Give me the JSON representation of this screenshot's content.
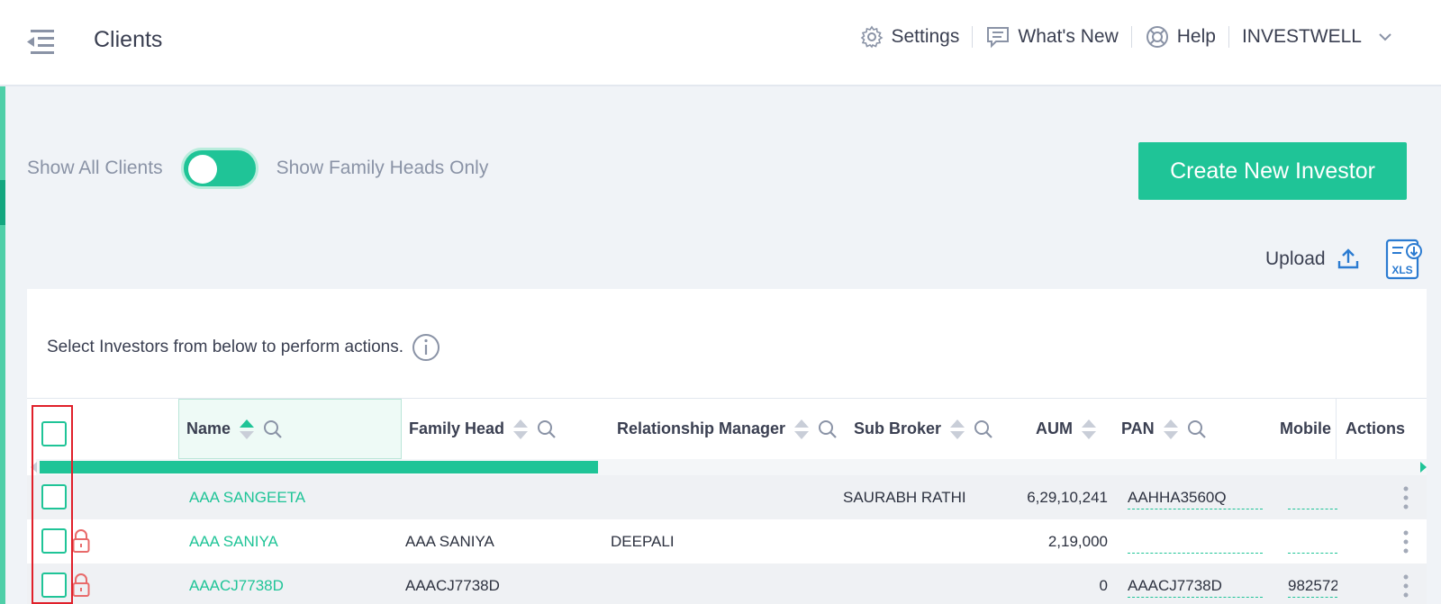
{
  "header": {
    "title": "Clients",
    "nav": {
      "settings": "Settings",
      "whats_new": "What's New",
      "help": "Help",
      "account": "INVESTWELL"
    }
  },
  "filters": {
    "left_label": "Show All Clients",
    "right_label": "Show Family Heads Only",
    "toggle_on": true
  },
  "actions": {
    "create_label": "Create New Investor",
    "upload_label": "Upload",
    "xls_label": "XLS"
  },
  "panel": {
    "hint": "Select Investors from below to perform actions."
  },
  "table": {
    "columns": {
      "name": "Name",
      "family_head": "Family Head",
      "relationship_manager": "Relationship Manager",
      "sub_broker": "Sub Broker",
      "aum": "AUM",
      "pan": "PAN",
      "mobile": "Mobile",
      "actions": "Actions"
    },
    "rows": [
      {
        "name": "AAA SANGEETA",
        "family_head": "",
        "relationship_manager": "",
        "sub_broker": "SAURABH RATHI",
        "aum": "6,29,10,241",
        "pan": "AAHHA3560Q",
        "mobile": "",
        "locked": false
      },
      {
        "name": "AAA SANIYA",
        "family_head": "AAA SANIYA",
        "relationship_manager": "DEEPALI",
        "sub_broker": "",
        "aum": "2,19,000",
        "pan": "",
        "mobile": "",
        "locked": true
      },
      {
        "name": "AAACJ7738D",
        "family_head": "AAACJ7738D",
        "relationship_manager": "",
        "sub_broker": "",
        "aum": "0",
        "pan": "AAACJ7738D",
        "mobile": "982572",
        "locked": true
      }
    ]
  },
  "colors": {
    "accent": "#1fc497",
    "highlight": "#e0202a"
  }
}
